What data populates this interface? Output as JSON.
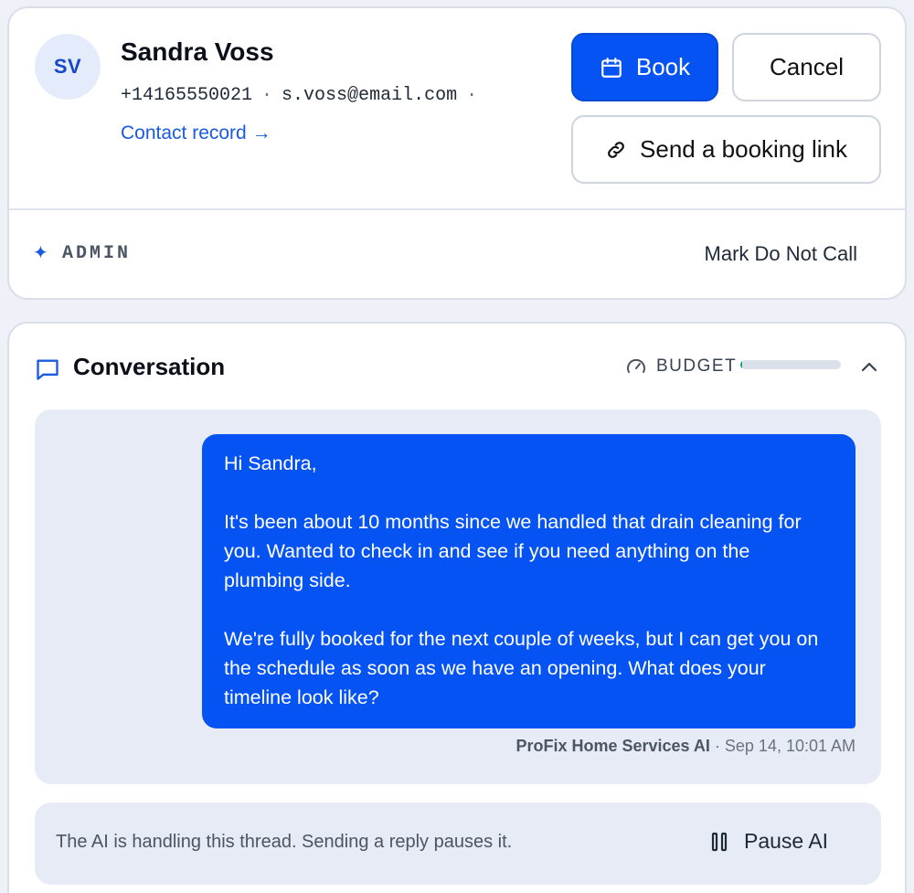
{
  "contact": {
    "initials": "SV",
    "name": "Sandra Voss",
    "phone": "+14165550021",
    "email": "s.voss@email.com",
    "separator": "·",
    "record_link": "Contact record →"
  },
  "actions": {
    "book_label": "Book",
    "cancel_label": "Cancel",
    "booking_link_label": "Send a booking link"
  },
  "admin": {
    "label": "ADMIN",
    "do_not_call_label": "Mark Do Not Call"
  },
  "conversation": {
    "title": "Conversation",
    "budget_label": "BUDGET",
    "budget_used_fraction": 0.02,
    "messages": [
      {
        "paragraphs": [
          "Hi Sandra,",
          "It's been about 10 months since we handled that drain cleaning for you. Wanted to check in and see if you need anything on the plumbing side.",
          "We're fully booked for the next couple of weeks, but I can get you on the schedule as soon as we have an opening. What does your timeline look like?"
        ],
        "sender": "ProFix Home Services AI",
        "timestamp": "Sep 14, 10:01 AM"
      }
    ]
  },
  "ai_status": {
    "note": "The AI is handling this thread. Sending a reply pauses it.",
    "pause_label": "Pause AI"
  },
  "colors": {
    "accent": "#0653f4",
    "budget_fill": "#10a37f"
  }
}
